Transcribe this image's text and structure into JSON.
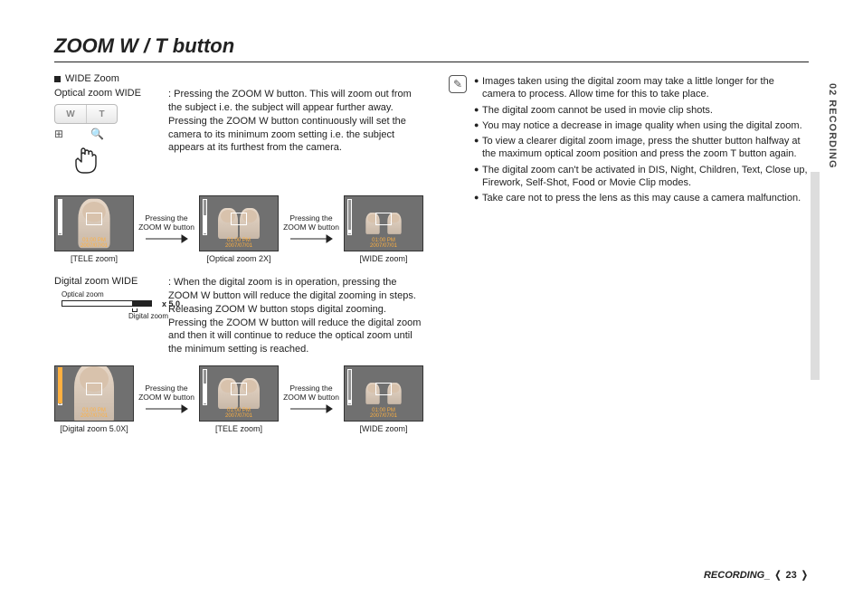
{
  "title": "ZOOM W / T button",
  "wideZoom": {
    "sectionLabel": "WIDE Zoom",
    "optical": {
      "term": "Optical zoom WIDE",
      "desc": ": Pressing the ZOOM W button. This will zoom out from the subject i.e. the subject will appear further away. Pressing the ZOOM W button continuously will set the camera to its minimum zoom setting i.e. the subject appears at its furthest from the camera."
    },
    "wtButton": {
      "w": "W",
      "t": "T"
    },
    "icons": {
      "grid": "⊞",
      "mag": "🔍"
    },
    "thumbs1": {
      "arrowText": "Pressing the ZOOM W button",
      "caps": [
        "[TELE zoom]",
        "[Optical zoom 2X]",
        "[WIDE zoom]"
      ]
    },
    "digital": {
      "term": "Digital zoom WIDE",
      "desc": ": When the digital zoom is in operation, pressing the ZOOM W button will reduce the digital zooming in steps. Releasing ZOOM W button stops digital zooming. Pressing the ZOOM W button will reduce the digital zoom and then it will continue to reduce the optical zoom until the minimum setting is reached."
    },
    "bar": {
      "opt": "Optical zoom",
      "dig": "Digital zoom",
      "x": "x 5.0"
    },
    "thumbs2": {
      "arrowText": "Pressing the ZOOM W button",
      "caps": [
        "[Digital zoom 5.0X]",
        "[TELE zoom]",
        "[WIDE zoom]"
      ]
    }
  },
  "notes": [
    "Images taken using the digital zoom may take a little longer for the camera to process. Allow time for this to take place.",
    "The digital zoom cannot be used in movie clip shots.",
    "You may notice a decrease in image quality when using the digital zoom.",
    "To view a clearer digital zoom image, press the shutter button halfway at the maximum optical zoom position and press the zoom T button again.",
    "The digital zoom can't be activated in DIS, Night, Children, Text, Close up, Firework, Self-Shot, Food or Movie Clip modes.",
    "Take care not to press the lens as this may cause a camera malfunction."
  ],
  "sideTab": "02 RECORDING",
  "footer": {
    "label": "RECORDING_",
    "page": "23"
  }
}
